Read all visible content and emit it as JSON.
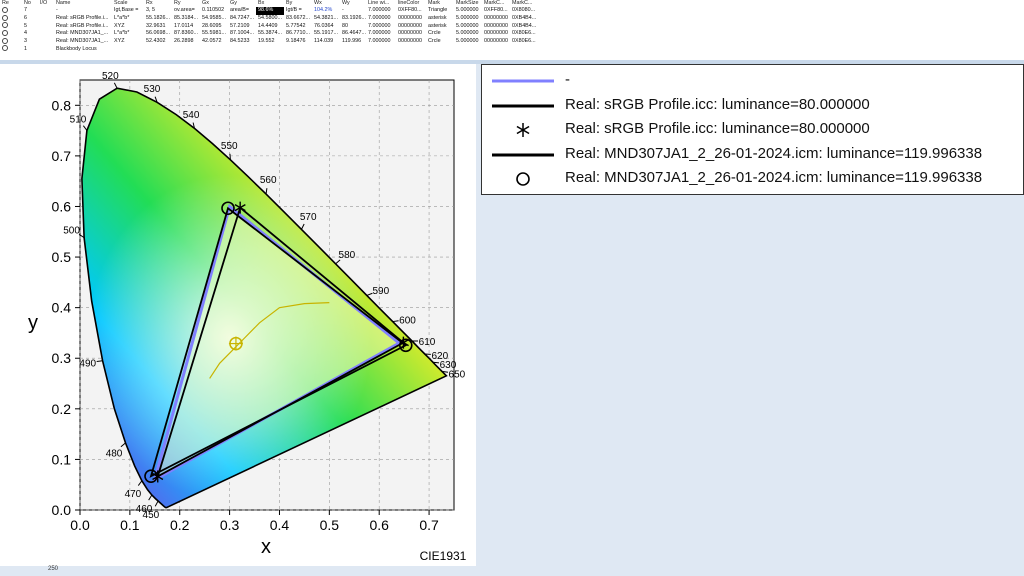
{
  "table": {
    "columns": [
      "Re",
      "No",
      "I/O",
      "Name",
      "Scale",
      "Rx",
      "Ry",
      "Gx",
      "Gy",
      "Bx",
      "By",
      "Wx",
      "Wy",
      "Line wi...",
      "lineColor",
      "Mark",
      "MarkSize",
      "MarkC...",
      "MarkC..."
    ],
    "rows": [
      [
        "",
        "7",
        "",
        "-",
        "Igt,Base =",
        "3, 5",
        "ov.area=",
        "0.110502",
        "area/B=",
        "98.6%",
        "Igt/B =",
        "104.2%",
        "-",
        "7.000000",
        "0XFF80...",
        "Triangle",
        "5.000000",
        "0XFF80...",
        "0X8080..."
      ],
      [
        "",
        "6",
        "",
        "Real: sRGB Profile.i...",
        "L*a*b*",
        "55.1826...",
        "85.3184...",
        "54.9585...",
        "84.7247...",
        "54.5800...",
        "83.6672...",
        "54.3821...",
        "83.1926...",
        "7.000000",
        "00000000",
        "asterisk",
        "5.000000",
        "00000000",
        "0XB4B4..."
      ],
      [
        "",
        "5",
        "",
        "Real: sRGB Profile.i...",
        "XYZ",
        "32.9631",
        "17.0114",
        "28.6095",
        "57.2109",
        "14.4409",
        "5.77542",
        "76.0364",
        "80",
        "7.000000",
        "00000000",
        "asterisk",
        "5.000000",
        "00000000",
        "0XB4B4..."
      ],
      [
        "",
        "4",
        "",
        "Real: MND307JA1_...",
        "L*a*b*",
        "56.0698...",
        "87.8360...",
        "55.5981...",
        "87.1004...",
        "55.3874...",
        "86.7710...",
        "55.1917...",
        "86.4647...",
        "7.000000",
        "00000000",
        "Crcle",
        "5.000000",
        "00000000",
        "0X80E6..."
      ],
      [
        "",
        "3",
        "",
        "Real: MND307JA1_...",
        "XYZ",
        "52.4302",
        "26.2898",
        "42.0572",
        "84.5233",
        "19.552",
        "9.18476",
        "114.039",
        "119.996",
        "7.000000",
        "00000000",
        "Crcle",
        "5.000000",
        "00000000",
        "0X80E6..."
      ],
      [
        "",
        "1",
        "",
        "Blackbody Locus",
        "",
        "",
        "",
        "",
        "",
        "",
        "",
        "",
        "",
        "",
        "",
        "",
        "",
        "",
        ""
      ]
    ]
  },
  "chart_data": {
    "type": "scatter",
    "title": "",
    "xlabel": "x",
    "ylabel": "y",
    "watermark": "CIE1931",
    "xlim": [
      0.0,
      0.75
    ],
    "ylim": [
      0.0,
      0.85
    ],
    "x_ticks": [
      "0.0",
      "0.1",
      "0.2",
      "0.3",
      "0.4",
      "0.5",
      "0.6",
      "0.7"
    ],
    "y_ticks": [
      "0.0",
      "0.1",
      "0.2",
      "0.3",
      "0.4",
      "0.5",
      "0.6",
      "0.7",
      "0.8"
    ],
    "wavelength_labels": [
      {
        "nm": "450",
        "x": 0.1566,
        "y": 0.0177
      },
      {
        "nm": "460",
        "x": 0.144,
        "y": 0.0297
      },
      {
        "nm": "470",
        "x": 0.1241,
        "y": 0.0578
      },
      {
        "nm": "480",
        "x": 0.0913,
        "y": 0.1327
      },
      {
        "nm": "490",
        "x": 0.0454,
        "y": 0.295
      },
      {
        "nm": "500",
        "x": 0.0082,
        "y": 0.5384
      },
      {
        "nm": "510",
        "x": 0.0139,
        "y": 0.7502
      },
      {
        "nm": "520",
        "x": 0.0743,
        "y": 0.8338
      },
      {
        "nm": "530",
        "x": 0.1547,
        "y": 0.8059
      },
      {
        "nm": "540",
        "x": 0.2296,
        "y": 0.7543
      },
      {
        "nm": "550",
        "x": 0.3016,
        "y": 0.6923
      },
      {
        "nm": "560",
        "x": 0.3731,
        "y": 0.6245
      },
      {
        "nm": "570",
        "x": 0.4441,
        "y": 0.5547
      },
      {
        "nm": "580",
        "x": 0.5125,
        "y": 0.4866
      },
      {
        "nm": "590",
        "x": 0.5752,
        "y": 0.4242
      },
      {
        "nm": "600",
        "x": 0.627,
        "y": 0.3725
      },
      {
        "nm": "610",
        "x": 0.6658,
        "y": 0.334
      },
      {
        "nm": "620",
        "x": 0.6915,
        "y": 0.3083
      },
      {
        "nm": "630",
        "x": 0.7079,
        "y": 0.292
      },
      {
        "nm": "650",
        "x": 0.726,
        "y": 0.274
      }
    ],
    "locus": [
      [
        0.1741,
        0.005
      ],
      [
        0.1738,
        0.0049
      ],
      [
        0.1736,
        0.0049
      ],
      [
        0.1733,
        0.0048
      ],
      [
        0.173,
        0.0048
      ],
      [
        0.1726,
        0.0048
      ],
      [
        0.1721,
        0.0048
      ],
      [
        0.1714,
        0.0051
      ],
      [
        0.1703,
        0.0058
      ],
      [
        0.1689,
        0.0069
      ],
      [
        0.1669,
        0.0086
      ],
      [
        0.1644,
        0.0109
      ],
      [
        0.1611,
        0.0138
      ],
      [
        0.1566,
        0.0177
      ],
      [
        0.151,
        0.0227
      ],
      [
        0.144,
        0.0297
      ],
      [
        0.1355,
        0.0399
      ],
      [
        0.1241,
        0.0578
      ],
      [
        0.1096,
        0.0868
      ],
      [
        0.0913,
        0.1327
      ],
      [
        0.0687,
        0.2007
      ],
      [
        0.0454,
        0.295
      ],
      [
        0.0235,
        0.4127
      ],
      [
        0.0082,
        0.5384
      ],
      [
        0.0039,
        0.6548
      ],
      [
        0.0139,
        0.7502
      ],
      [
        0.0389,
        0.812
      ],
      [
        0.0743,
        0.8338
      ],
      [
        0.1142,
        0.8262
      ],
      [
        0.1547,
        0.8059
      ],
      [
        0.1929,
        0.7816
      ],
      [
        0.2296,
        0.7543
      ],
      [
        0.2658,
        0.7243
      ],
      [
        0.3016,
        0.6923
      ],
      [
        0.3373,
        0.6589
      ],
      [
        0.3731,
        0.6245
      ],
      [
        0.4087,
        0.5896
      ],
      [
        0.4441,
        0.5547
      ],
      [
        0.4788,
        0.5202
      ],
      [
        0.5125,
        0.4866
      ],
      [
        0.5448,
        0.4544
      ],
      [
        0.5752,
        0.4242
      ],
      [
        0.6029,
        0.3965
      ],
      [
        0.627,
        0.3725
      ],
      [
        0.6482,
        0.3514
      ],
      [
        0.6658,
        0.334
      ],
      [
        0.6801,
        0.3197
      ],
      [
        0.6915,
        0.3083
      ],
      [
        0.7006,
        0.2993
      ],
      [
        0.7079,
        0.292
      ],
      [
        0.714,
        0.2859
      ],
      [
        0.719,
        0.2809
      ],
      [
        0.723,
        0.277
      ],
      [
        0.726,
        0.274
      ],
      [
        0.7283,
        0.2717
      ],
      [
        0.73,
        0.27
      ],
      [
        0.7311,
        0.2689
      ],
      [
        0.732,
        0.268
      ],
      [
        0.7327,
        0.2673
      ],
      [
        0.7334,
        0.2666
      ],
      [
        0.734,
        0.266
      ],
      [
        0.7344,
        0.2656
      ],
      [
        0.7346,
        0.2654
      ],
      [
        0.7347,
        0.2653
      ]
    ],
    "series": [
      {
        "name": "-",
        "marker": "none",
        "color": "#8080ff",
        "points": [
          [
            0.64,
            0.33
          ],
          [
            0.3,
            0.6
          ],
          [
            0.15,
            0.06
          ]
        ]
      },
      {
        "name": "Real: sRGB Profile.icc: luminance=80.000000",
        "marker": "asterisk",
        "color": "#000000",
        "points": [
          [
            0.6485,
            0.3308
          ],
          [
            0.3212,
            0.5977
          ],
          [
            0.1559,
            0.0663
          ]
        ]
      },
      {
        "name": "Real: MND307JA1_2_26-01-2024.icm: luminance=119.996338",
        "marker": "circle",
        "color": "#000000",
        "points": [
          [
            0.6533,
            0.3256
          ],
          [
            0.2968,
            0.5965
          ],
          [
            0.1424,
            0.0669
          ]
        ]
      }
    ],
    "white_point": {
      "x": 0.3127,
      "y": 0.329
    }
  },
  "legend": [
    {
      "label": "-",
      "kind": "line",
      "color": "#8080ff"
    },
    {
      "label": "Real: sRGB Profile.icc: luminance=80.000000",
      "kind": "line",
      "color": "#000000"
    },
    {
      "label": "Real: sRGB Profile.icc: luminance=80.000000",
      "kind": "asterisk",
      "color": "#000000"
    },
    {
      "label": "Real: MND307JA1_2_26-01-2024.icm: luminance=119.996338",
      "kind": "line",
      "color": "#000000"
    },
    {
      "label": "Real: MND307JA1_2_26-01-2024.icm: luminance=119.996338",
      "kind": "circle",
      "color": "#000000"
    }
  ],
  "statusbar": {
    "text": "250"
  }
}
